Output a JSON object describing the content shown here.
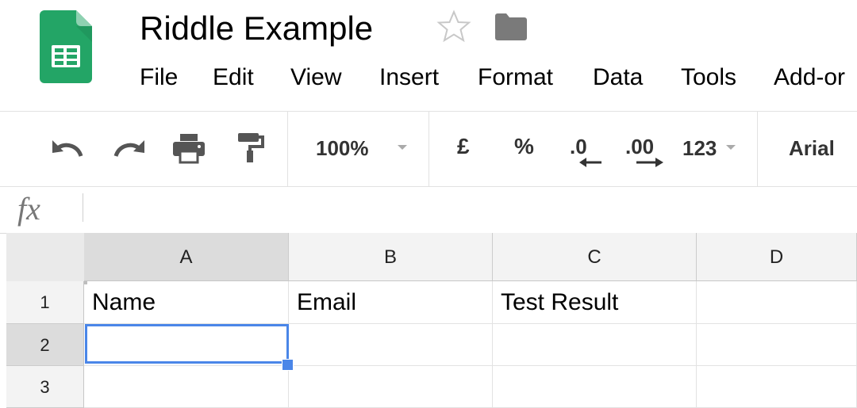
{
  "app": {
    "document_title": "Riddle Example",
    "icons": {
      "logo": "sheets-logo-icon",
      "star": "star-icon",
      "folder": "folder-icon"
    },
    "colors": {
      "brand_green": "#23a566",
      "selection_blue": "#4a86e8"
    }
  },
  "menu": {
    "items": [
      "File",
      "Edit",
      "View",
      "Insert",
      "Format",
      "Data",
      "Tools",
      "Add-or"
    ]
  },
  "toolbar": {
    "zoom": "100%",
    "currency": "£",
    "percent": "%",
    "decrease_decimals": ".0",
    "increase_decimals": ".00",
    "number_format": "123",
    "font": "Arial",
    "icons": [
      "undo-icon",
      "redo-icon",
      "print-icon",
      "paint-format-icon",
      "dropdown-icon"
    ]
  },
  "formula_bar": {
    "label": "fx",
    "value": ""
  },
  "sheet": {
    "columns": [
      "A",
      "B",
      "C",
      "D"
    ],
    "rows": [
      "1",
      "2",
      "3"
    ],
    "cells": [
      [
        "Name",
        "Email",
        "Test Result",
        ""
      ],
      [
        "",
        "",
        "",
        ""
      ],
      [
        "",
        "",
        "",
        ""
      ]
    ],
    "selected_cell": "A2"
  }
}
